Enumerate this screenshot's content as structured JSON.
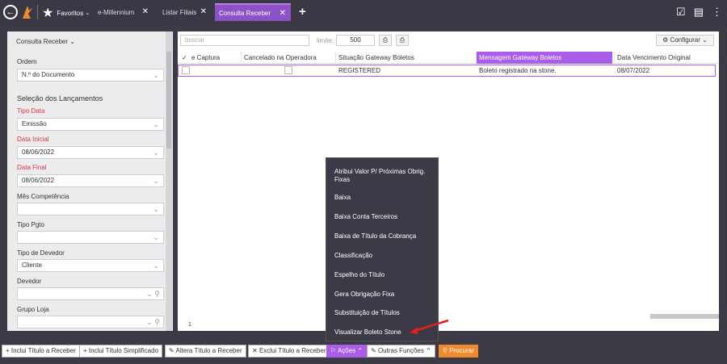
{
  "topbar": {
    "favorites_label": "Favoritos",
    "tabs": [
      {
        "label": "e-Millennium"
      },
      {
        "label": "Listar Filiais"
      },
      {
        "label": "Consulta Receber"
      }
    ]
  },
  "sidebar": {
    "title": "Consulta Receber",
    "ordem_label": "Ordem",
    "ordem_value": "N.º do Documento",
    "section_title": "Seleção dos Lançamentos",
    "tipo_data_label": "Tipo Data",
    "tipo_data_value": "Emissão",
    "data_inicial_label": "Data Inicial",
    "data_inicial_value": "08/06/2022",
    "data_final_label": "Data Final",
    "data_final_value": "08/06/2022",
    "mes_competencia_label": "Mês Competência",
    "tipo_pgto_label": "Tipo Pgto",
    "tipo_devedor_label": "Tipo de Devedor",
    "tipo_devedor_value": "Cliente",
    "devedor_label": "Devedor",
    "grupo_loja_label": "Grupo Loja"
  },
  "main": {
    "search_placeholder": "buscar",
    "limit_label": "limite:",
    "limit_value": "500",
    "configure_label": "Configurar",
    "columns": [
      "e Captura",
      "Cancelado na Operadora",
      "Situação Gateway Boletos",
      "Mensagem Gateway Boletos",
      "Data Vencimento Original"
    ],
    "row": {
      "situacao": "REGISTERED",
      "mensagem": "Boleto registrado na stone.",
      "vencimento": "08/07/2022"
    },
    "page_number": "1"
  },
  "menu": {
    "items": [
      "Atribui Valor P/ Próximas Obrig. Fixas",
      "Baixa",
      "Baixa Conta Terceiros",
      "Baixa de Título da Cobrança",
      "Classificação",
      "Espelho do Título",
      "Gera Obrigação Fixa",
      "Substituição de Títulos",
      "Visualizar Boleto Stone"
    ]
  },
  "toolbar": {
    "inclui_titulo": "Inclui Título a Receber",
    "inclui_simplificado": "Inclui Título Simplificado",
    "altera_titulo": "Altera Título a Receber",
    "exclui_titulo": "Exclui Título a Receber",
    "acoes": "Ações",
    "outras_funcoes": "Outras Funções",
    "procurar": "Procurar"
  },
  "colors": {
    "accent": "#a95de8",
    "dark": "#3c3a45",
    "orange": "#f08a2d",
    "arrow": "#e02020"
  }
}
